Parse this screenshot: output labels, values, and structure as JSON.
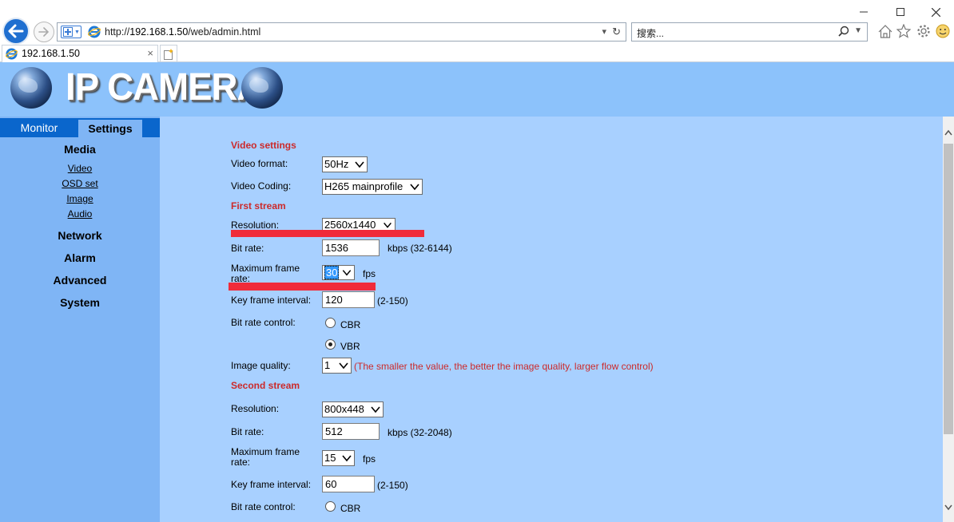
{
  "browser": {
    "url_prefix": "http://",
    "url_host": "192.168.1.50",
    "url_path": "/web/admin.html",
    "search_placeholder": "搜索...",
    "tab_title": "192.168.1.50"
  },
  "header": {
    "logo_text": "IP CAMERA"
  },
  "sidebar": {
    "tabs": [
      "Monitor",
      "Settings"
    ],
    "active_tab": "Settings",
    "media": "Media",
    "media_items": [
      "Video",
      "OSD set",
      "Image",
      "Audio"
    ],
    "sections": [
      "Network",
      "Alarm",
      "Advanced",
      "System"
    ]
  },
  "video_settings": {
    "title": "Video settings",
    "video_format_label": "Video format:",
    "video_format": "50Hz",
    "video_coding_label": "Video Coding:",
    "video_coding": "H265 mainprofile"
  },
  "first_stream": {
    "title": "First stream",
    "resolution_label": "Resolution:",
    "resolution": "2560x1440",
    "bitrate_label": "Bit rate:",
    "bitrate": "1536",
    "bitrate_hint": "kbps (32-6144)",
    "max_frame_label_1": "Maximum frame",
    "max_frame_label_2": "rate:",
    "max_frame": "30",
    "fps_unit": "fps",
    "key_frame_label": "Key frame interval:",
    "key_frame": "120",
    "key_frame_hint": "(2-150)",
    "bitrate_control_label": "Bit rate control:",
    "cbr": "CBR",
    "vbr": "VBR",
    "bitrate_control_selected": "VBR",
    "image_quality_label": "Image quality:",
    "image_quality": "1",
    "image_quality_note": "(The smaller the value, the better the image quality, larger flow control)"
  },
  "second_stream": {
    "title": "Second stream",
    "resolution_label": "Resolution:",
    "resolution": "800x448",
    "bitrate_label": "Bit rate:",
    "bitrate": "512",
    "bitrate_hint": "kbps (32-2048)",
    "max_frame_label_1": "Maximum frame",
    "max_frame_label_2": "rate:",
    "max_frame": "15",
    "fps_unit": "fps",
    "key_frame_label": "Key frame interval:",
    "key_frame": "60",
    "key_frame_hint": "(2-150)",
    "bitrate_control_label": "Bit rate control:",
    "cbr": "CBR"
  },
  "colors": {
    "page_bg": "#a8d0ff",
    "header_bg": "#8cc2fb",
    "sidebar_bg": "#7fb5f5",
    "tabbar_bg": "#0a66cc",
    "section_red": "#cc2a2a",
    "annotation_red": "#f02b3a"
  }
}
